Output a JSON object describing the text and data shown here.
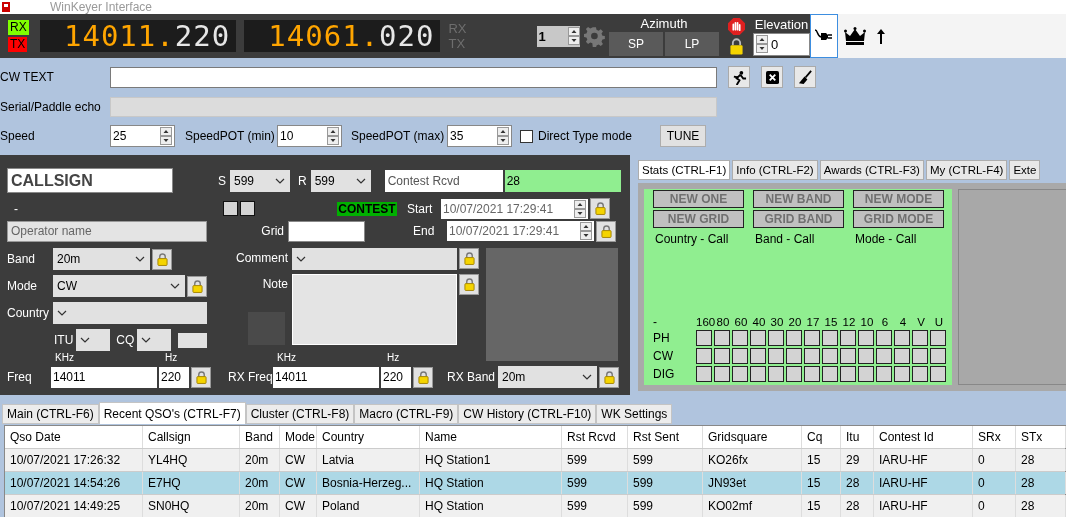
{
  "window": {
    "title": "WinKeyer Interface"
  },
  "indicators": [
    {
      "label": "RX",
      "color": "#80ff00"
    },
    {
      "label": "TX",
      "color": "#ff0000"
    }
  ],
  "displays": [
    {
      "main": "14011",
      "sep": ".",
      "sub": "220"
    },
    {
      "main": "14061",
      "sep": ".",
      "sub": "020"
    }
  ],
  "vfo_labels": [
    "RX",
    "TX"
  ],
  "rotator": {
    "spin": "1",
    "azimuth_label": "Azimuth",
    "buttons": [
      "SP",
      "LP"
    ],
    "elevation_label": "Elevation",
    "elevation": "0"
  },
  "cw": {
    "text_label": "CW TEXT",
    "echo_label": "Serial/Paddle echo",
    "speed_label": "Speed",
    "speed": "25",
    "pot_min_label": "SpeedPOT (min)",
    "pot_min": "10",
    "pot_max_label": "SpeedPOT (max)",
    "pot_max": "35",
    "direct_type": {
      "label": "Direct Type mode",
      "checked": false
    },
    "tune": "TUNE"
  },
  "qso": {
    "callsign_placeholder": "CALLSIGN",
    "s_label": "S",
    "s": "599",
    "r_label": "R",
    "r": "599",
    "contest_rcvd_label": "Contest Rcvd",
    "contest_rcvd": "28",
    "dash": "-",
    "contest_badge": "CONTEST",
    "start_label": "Start",
    "start": "10/07/2021 17:29:41",
    "end_label": "End",
    "end": "10/07/2021 17:29:41",
    "operator_placeholder": "Operator name",
    "grid_label": "Grid",
    "band_label": "Band",
    "band": "20m",
    "comment_label": "Comment",
    "mode_label": "Mode",
    "mode": "CW",
    "note_label": "Note",
    "country_label": "Country",
    "itu_label": "ITU",
    "cq_label": "CQ",
    "freqs": [
      {
        "label": "Freq",
        "khz_unit": "KHz",
        "khz": "14011",
        "hz_unit": "Hz",
        "hz": "220"
      },
      {
        "label": "RX Freq",
        "khz_unit": "KHz",
        "khz": "14011",
        "hz_unit": "Hz",
        "hz": "220"
      }
    ],
    "rx_band_label": "RX Band",
    "rx_band": "20m"
  },
  "stats_tabs": [
    {
      "label": "Stats (CTRL-F1)",
      "selected": true
    },
    {
      "label": "Info (CTRL-F2)",
      "selected": false
    },
    {
      "label": "Awards (CTRL-F3)",
      "selected": false
    },
    {
      "label": "My (CTRL-F4)",
      "selected": false
    },
    {
      "label": "Exte",
      "selected": false
    }
  ],
  "stats": {
    "flags": [
      "NEW ONE",
      "NEW BAND",
      "NEW MODE",
      "NEW GRID",
      "GRID BAND",
      "GRID MODE"
    ],
    "captions": [
      "Country - Call",
      "Band - Call",
      "Mode - Call"
    ],
    "corner": "-",
    "bands": [
      "160",
      "80",
      "60",
      "40",
      "30",
      "20",
      "17",
      "15",
      "12",
      "10",
      "6",
      "4",
      "V",
      "U"
    ],
    "modes": [
      "PH",
      "CW",
      "DIG"
    ]
  },
  "bottom_tabs": [
    {
      "label": "Main (CTRL-F6)",
      "selected": false
    },
    {
      "label": "Recent QSO's (CTRL-F7)",
      "selected": true
    },
    {
      "label": "Cluster (CTRL-F8)",
      "selected": false
    },
    {
      "label": "Macro (CTRL-F9)",
      "selected": false
    },
    {
      "label": "CW History (CTRL-F10)",
      "selected": false
    },
    {
      "label": "WK Settings",
      "selected": false
    }
  ],
  "table": {
    "columns": [
      "Qso Date",
      "Callsign",
      "Band",
      "Mode",
      "Country",
      "Name",
      "Rst Rcvd",
      "Rst Sent",
      "Gridsquare",
      "Cq",
      "Itu",
      "Contest Id",
      "SRx",
      "STx"
    ],
    "rows": [
      {
        "selected": false,
        "cells": [
          "10/07/2021 17:26:32",
          "YL4HQ",
          "20m",
          "CW",
          "Latvia",
          "HQ Station1",
          "599",
          "599",
          "KO26fx",
          "15",
          "29",
          "IARU-HF",
          "0",
          "28"
        ]
      },
      {
        "selected": true,
        "cells": [
          "10/07/2021 14:54:26",
          "E7HQ",
          "20m",
          "CW",
          "Bosnia-Herzeg...",
          "HQ Station",
          "599",
          "599",
          "JN93et",
          "15",
          "28",
          "IARU-HF",
          "0",
          "28"
        ]
      },
      {
        "selected": false,
        "cells": [
          "10/07/2021 14:49:25",
          "SN0HQ",
          "20m",
          "CW",
          "Poland",
          "HQ Station",
          "599",
          "599",
          "KO02mf",
          "15",
          "28",
          "IARU-HF",
          "0",
          "28"
        ]
      }
    ]
  }
}
